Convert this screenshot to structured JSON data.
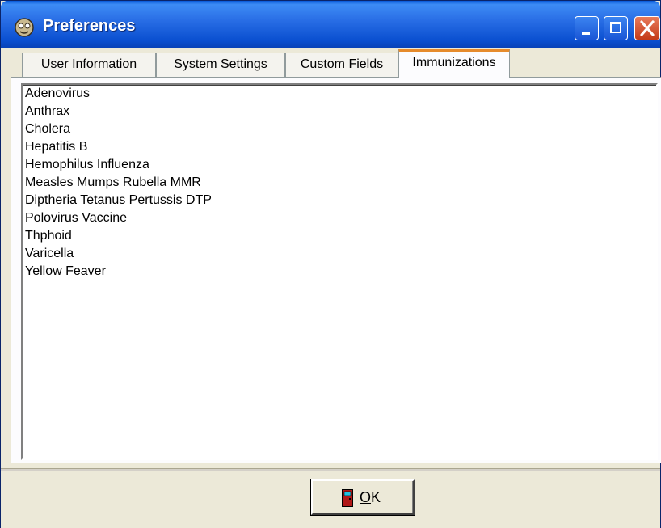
{
  "window": {
    "title": "Preferences",
    "app_icon": "app-logo-icon",
    "controls": {
      "minimize": "minimize-icon",
      "maximize": "maximize-icon",
      "close": "close-icon"
    },
    "colors": {
      "titlebar": "#2a6fe6",
      "close": "#c43a18",
      "face": "#ece9d8",
      "active_tab_accent": "#e68b2c"
    }
  },
  "tabs": [
    {
      "label": "User Information",
      "active": false
    },
    {
      "label": "System Settings",
      "active": false
    },
    {
      "label": "Custom Fields",
      "active": false
    },
    {
      "label": "Immunizations",
      "active": true
    }
  ],
  "immunizations": [
    "Adenovirus",
    "Anthrax",
    "Cholera",
    "Hepatitis B",
    "Hemophilus Influenza",
    "Measles Mumps Rubella MMR",
    "Diptheria Tetanus Pertussis DTP",
    "Polovirus Vaccine",
    "Thphoid",
    "Varicella",
    "Yellow Feaver"
  ],
  "footer": {
    "ok_button": {
      "label": "OK",
      "icon": "door-icon"
    }
  }
}
